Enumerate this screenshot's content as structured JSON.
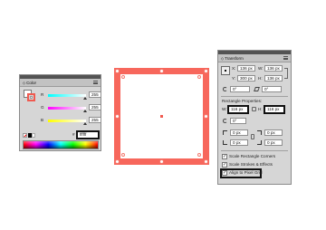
{
  "color_panel": {
    "tab_label": "Color",
    "channels": [
      {
        "label": "R",
        "value": "255"
      },
      {
        "label": "G",
        "value": "255"
      },
      {
        "label": "B",
        "value": "255"
      }
    ],
    "hex_label": "#",
    "hex_value": "ffffff",
    "colors": {
      "fill": "#ffffff",
      "stroke": "#f05a50"
    }
  },
  "canvas": {
    "rect_stroke": "#f7675c",
    "rect_fill": "#ffffff"
  },
  "transform_panel": {
    "tab_label": "Transform",
    "x_label": "X:",
    "x_value": "136 px",
    "y_label": "Y:",
    "y_value": "300 px",
    "w_label": "W:",
    "w_value": "136 px",
    "h_label": "H:",
    "h_value": "136 px",
    "angle_value": "0°",
    "shear_value": "0°",
    "rect_props_title": "Rectangle Properties:",
    "rect_w_value": "116 px",
    "rect_h_value": "116 px",
    "rect_angle_value": "0°",
    "corner_values": [
      "0 px",
      "0 px",
      "0 px",
      "0 px"
    ],
    "options": [
      {
        "label": "Scale Rectangle Corners",
        "checked": true
      },
      {
        "label": "Scale Strokes & Effects",
        "checked": true
      },
      {
        "label": "Align to Pixel Grid",
        "checked": true
      }
    ]
  }
}
